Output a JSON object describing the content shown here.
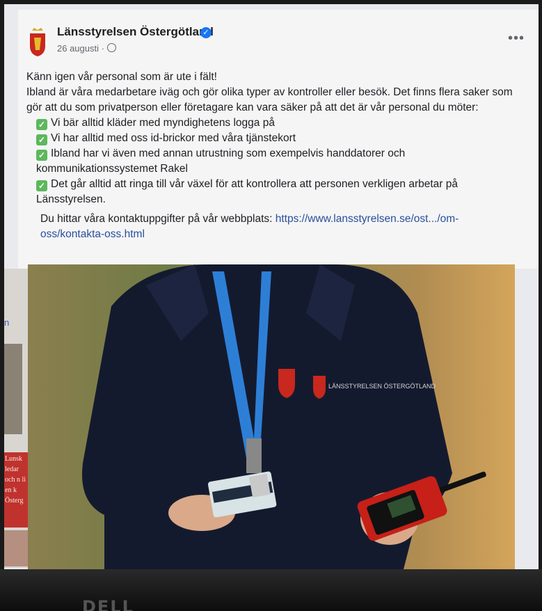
{
  "post": {
    "page_name": "Länsstyrelsen Östergötland",
    "date": "26 augusti ·",
    "intro": "Känn igen vår personal som är ute i fält!",
    "paragraph": "Ibland är våra medarbetare iväg och gör olika typer av kontroller eller besök. Det finns flera saker som gör att du som privatperson eller företagare kan vara säker på att det är vår personal du möter:",
    "bullets": [
      "Vi bär alltid kläder med myndighetens logga på",
      "Vi har alltid med oss id-brickor med våra tjänstekort",
      "Ibland har vi även med annan utrustning som exempelvis handdatorer och kommunikationssystemet Rakel",
      "Det går alltid att ringa till vår växel för att kontrollera att personen verkligen arbetar på Länsstyrelsen."
    ],
    "contact_text": "Du hittar våra kontaktuppgifter på vår webbplats:",
    "contact_link": "https://www.lansstyrelsen.se/ost.../om-oss/kontakta-oss.html",
    "jacket_logo_text": "LÄNSSTYRELSEN ÖSTERGÖTLAND"
  },
  "sidebar": {
    "link_char": "n",
    "thumb_text": "Lunsk ledar och n li en k Österg"
  },
  "monitor": {
    "brand": "DELL"
  },
  "colors": {
    "accent": "#1877f2",
    "link": "#2a4f99",
    "check": "#5cb85c"
  },
  "icons": {
    "verified": "verified-badge-icon",
    "globe": "globe-icon",
    "more": "more-icon",
    "check": "check-mark-icon"
  }
}
